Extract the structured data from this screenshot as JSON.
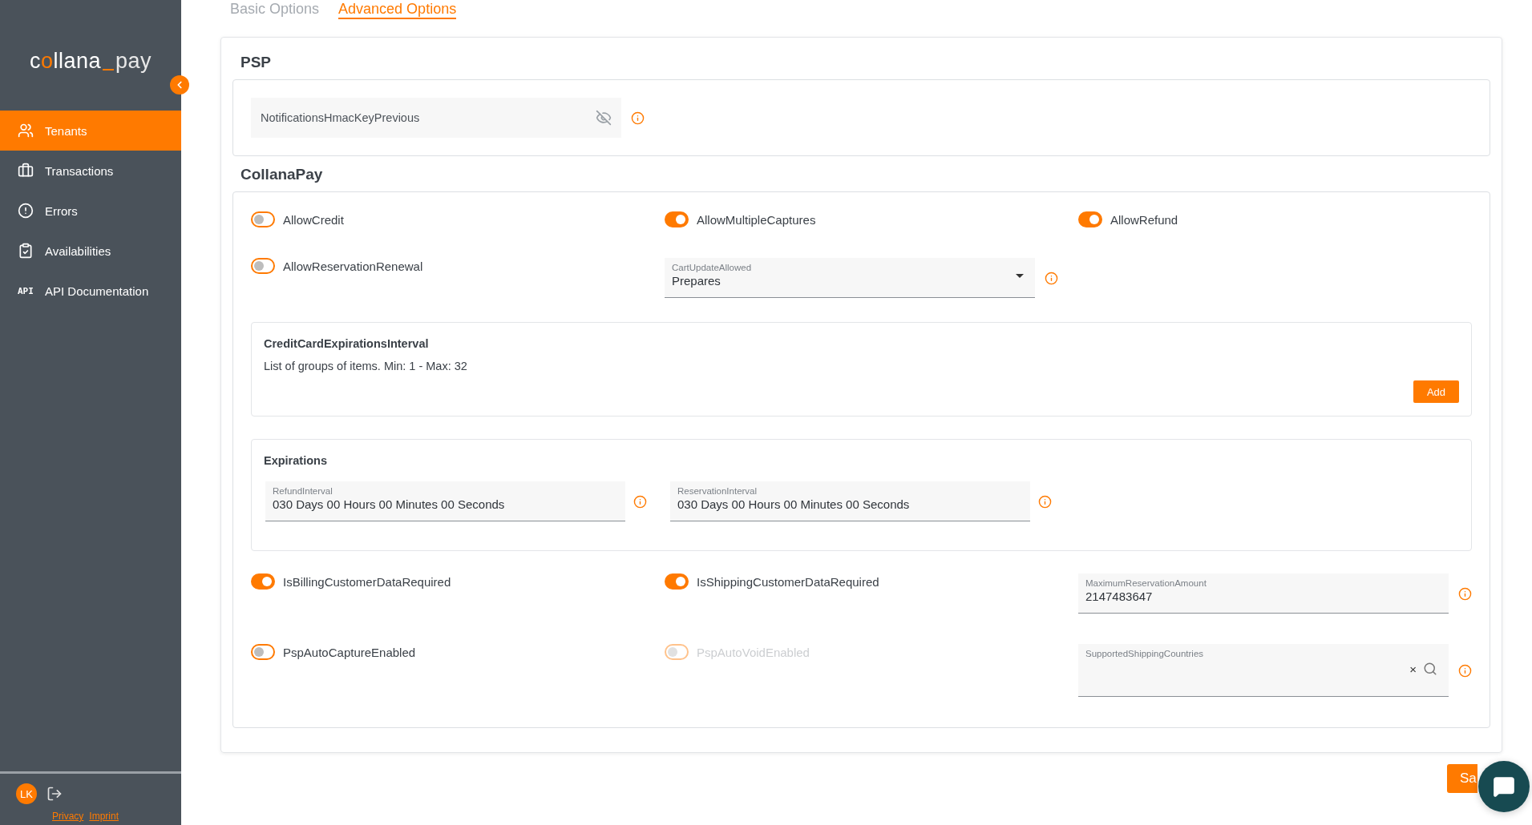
{
  "sidebar": {
    "logo": {
      "main": "collana",
      "suffix": "pay"
    },
    "items": [
      {
        "label": "Tenants",
        "selected": true
      },
      {
        "label": "Transactions",
        "selected": false
      },
      {
        "label": "Errors",
        "selected": false
      },
      {
        "label": "Availabilities",
        "selected": false
      },
      {
        "label": "API Documentation",
        "selected": false,
        "icon_text": "API"
      }
    ],
    "user": {
      "initials": "LK"
    },
    "links": [
      "Privacy",
      "Imprint"
    ]
  },
  "tabs": [
    {
      "label": "Basic Options",
      "selected": false
    },
    {
      "label": "Advanced Options",
      "selected": true
    }
  ],
  "psp": {
    "title": "PSP",
    "field": {
      "placeholder": "NotificationsHmacKeyPrevious"
    }
  },
  "collanapay": {
    "title": "CollanaPay",
    "rows": [
      [
        {
          "kind": "toggle",
          "label": "AllowCredit",
          "on": false,
          "disabled": false
        },
        {
          "kind": "toggle",
          "label": "AllowMultipleCaptures",
          "on": true,
          "disabled": false
        },
        {
          "kind": "toggle",
          "label": "AllowRefund",
          "on": true,
          "disabled": false
        }
      ],
      [
        {
          "kind": "toggle",
          "label": "AllowReservationRenewal",
          "on": false,
          "disabled": false
        },
        {
          "kind": "select",
          "label": "CartUpdateAllowed",
          "value": "Prepares"
        }
      ]
    ],
    "list_group": {
      "title": "CreditCardExpirationsInterval",
      "description": "List of groups of items. Min: 1 - Max: 32",
      "button": "Add"
    },
    "expirations": {
      "title": "Expirations",
      "fields": [
        {
          "label": "RefundInterval",
          "value": "030 Days 00 Hours 00 Minutes 00 Seconds"
        },
        {
          "label": "ReservationInterval",
          "value": "030 Days 00 Hours 00 Minutes 00 Seconds"
        }
      ]
    },
    "rows2": [
      [
        {
          "kind": "toggle",
          "label": "IsBillingCustomerDataRequired",
          "on": true,
          "disabled": false
        },
        {
          "kind": "toggle",
          "label": "IsShippingCustomerDataRequired",
          "on": true,
          "disabled": false
        },
        {
          "kind": "field",
          "label": "MaximumReservationAmount",
          "value": "2147483647"
        }
      ],
      [
        {
          "kind": "toggle",
          "label": "PspAutoCaptureEnabled",
          "on": false,
          "disabled": false
        },
        {
          "kind": "toggle",
          "label": "PspAutoVoidEnabled",
          "on": false,
          "disabled": true
        },
        {
          "kind": "search",
          "label": "SupportedShippingCountries",
          "clear": "×"
        }
      ]
    ]
  },
  "save_button": "Sa"
}
